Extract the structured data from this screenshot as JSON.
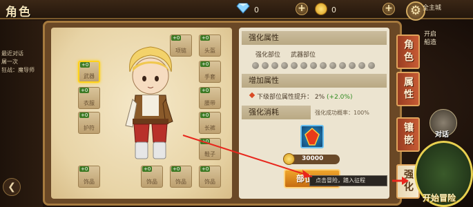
{
  "header": {
    "title": "角色",
    "diamond_count": "0",
    "gold_count": "0",
    "topright_line1": "全主城",
    "topright_line2": "开启",
    "topright_line3": "船造"
  },
  "left_panel": {
    "chips": [
      "最近对话",
      "屠一次",
      "狂战：魔导师"
    ]
  },
  "equipment_slots": [
    {
      "id": "weapon",
      "name": "武器",
      "level": "+0",
      "selected": true
    },
    {
      "id": "necklace",
      "name": "项链",
      "level": "+0"
    },
    {
      "id": "helmet",
      "name": "头盔",
      "level": "+0"
    },
    {
      "id": "clothes",
      "name": "衣服",
      "level": "+0"
    },
    {
      "id": "gloves",
      "name": "手套",
      "level": "+0"
    },
    {
      "id": "belt",
      "name": "腰带",
      "level": "+0"
    },
    {
      "id": "shoulder",
      "name": "护符",
      "level": "+0"
    },
    {
      "id": "pants",
      "name": "长裤",
      "level": "+0"
    },
    {
      "id": "shoes",
      "name": "鞋子",
      "level": "+0"
    },
    {
      "id": "ornament1",
      "name": "饰品",
      "level": "+0"
    },
    {
      "id": "ornament2",
      "name": "饰品",
      "level": "+0"
    },
    {
      "id": "ornament3",
      "name": "饰品",
      "level": "+0"
    },
    {
      "id": "ornament4",
      "name": "饰品",
      "level": "+0"
    }
  ],
  "strengthen_panel": {
    "attr_header": "强化属性",
    "part_label": "强化部位",
    "part_value": "武器部位",
    "bonus_header": "增加属性",
    "bonus_text": "下级部位属性提升：",
    "bonus_value": "2%",
    "bonus_delta": "(+2.0%)",
    "cost_header": "强化消耗",
    "success_rate": "强化成功概率：100%",
    "gold_cost": "30000",
    "action_button": "部位",
    "tooltip": "点击冒险，踏入征程"
  },
  "tabs": [
    {
      "label": "角色",
      "active": false
    },
    {
      "label": "属性",
      "active": false
    },
    {
      "label": "镶嵌",
      "active": false
    },
    {
      "label": "强化",
      "active": true
    }
  ],
  "side_buttons": {
    "talk_label": "对话",
    "adventure_label": "开始冒险"
  },
  "colors": {
    "accent_gold": "#ffd21a",
    "tab_red": "#c65a34",
    "action_orange": "#f0a62c",
    "annotation_arrow": "#e8261c"
  }
}
